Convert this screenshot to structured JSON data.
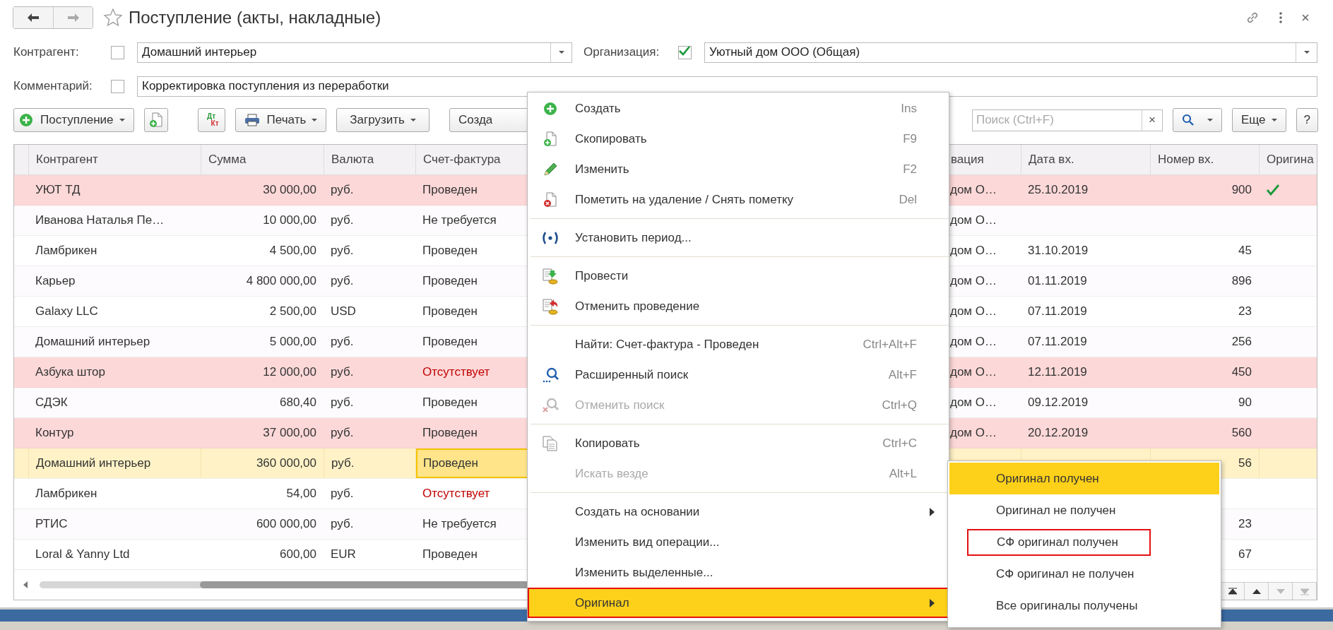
{
  "window": {
    "title": "Поступление (акты, накладные)"
  },
  "filters": [
    {
      "kind": "select",
      "label": "Контрагент:",
      "checked": false,
      "value": "Домашний интерьер"
    },
    {
      "kind": "select",
      "label": "Организация:",
      "checked": true,
      "value": "Уютный дом ООО (Общая)"
    },
    {
      "kind": "text",
      "label": "Комментарий:",
      "checked": false,
      "value": "Корректировка поступления из переработки"
    }
  ],
  "toolbar": {
    "left": [
      {
        "kind": "add",
        "label": "Поступление",
        "dropdown": true
      },
      {
        "kind": "copy"
      },
      {
        "kind": "accounts",
        "debit": "Дт",
        "credit": "Кт"
      },
      {
        "kind": "print",
        "label": "Печать",
        "dropdown": true
      },
      {
        "kind": "text",
        "label": "Загрузить",
        "dropdown": true
      },
      {
        "kind": "text",
        "label": "Созда",
        "dropdown": false
      }
    ],
    "search": {
      "placeholder": "Поиск (Ctrl+F)",
      "clear": "×"
    },
    "right": [
      {
        "kind": "search",
        "dropdown": true
      },
      {
        "kind": "text",
        "label": "Еще",
        "dropdown": true
      },
      {
        "kind": "text",
        "label": "?",
        "dropdown": false
      }
    ]
  },
  "table": {
    "columns": [
      "Контрагент",
      "Сумма",
      "Валюта",
      "Счет-фактура",
      "вация",
      "Дата вх.",
      "Номер вх.",
      "Оригина"
    ],
    "rows": [
      {
        "contractor": "УЮТ ТД",
        "sum": "30 000,00",
        "currency": "руб.",
        "invoice": "Проведен",
        "column_5": "дом О…",
        "date": "25.10.2019",
        "number": "900",
        "highlighted": true,
        "selected": false,
        "invoice_warning": false,
        "original_received": true
      },
      {
        "contractor": "Иванова Наталья Пе…",
        "sum": "10 000,00",
        "currency": "руб.",
        "invoice": "Не требуется",
        "column_5": "дом О…",
        "highlighted": false,
        "selected": false,
        "invoice_warning": false,
        "original_received": false
      },
      {
        "contractor": "Ламбрикен",
        "sum": "4 500,00",
        "currency": "руб.",
        "invoice": "Проведен",
        "column_5": "дом О…",
        "date": "31.10.2019",
        "number": "45",
        "highlighted": false,
        "selected": false,
        "invoice_warning": false,
        "original_received": false
      },
      {
        "contractor": "Карьер",
        "sum": "4 800 000,00",
        "currency": "руб.",
        "invoice": "Проведен",
        "column_5": "дом О…",
        "date": "01.11.2019",
        "number": "896",
        "highlighted": false,
        "selected": false,
        "invoice_warning": false,
        "original_received": false
      },
      {
        "contractor": "Galaxy LLC",
        "sum": "2 500,00",
        "currency": "USD",
        "invoice": "Проведен",
        "column_5": "дом О…",
        "date": "07.11.2019",
        "number": "23",
        "highlighted": false,
        "selected": false,
        "invoice_warning": false,
        "original_received": false
      },
      {
        "contractor": "Домашний интерьер",
        "sum": "5 000,00",
        "currency": "руб.",
        "invoice": "Проведен",
        "column_5": "дом О…",
        "date": "07.11.2019",
        "number": "256",
        "highlighted": false,
        "selected": false,
        "invoice_warning": false,
        "original_received": false
      },
      {
        "contractor": "Азбука штор",
        "sum": "12 000,00",
        "currency": "руб.",
        "invoice": "Отсутствует",
        "column_5": "дом О…",
        "date": "12.11.2019",
        "number": "450",
        "highlighted": true,
        "selected": false,
        "invoice_warning": true,
        "original_received": false
      },
      {
        "contractor": "СДЭК",
        "sum": "680,40",
        "currency": "руб.",
        "invoice": "Проведен",
        "column_5": "дом О…",
        "date": "09.12.2019",
        "number": "90",
        "highlighted": false,
        "selected": false,
        "invoice_warning": false,
        "original_received": false
      },
      {
        "contractor": "Контур",
        "sum": "37 000,00",
        "currency": "руб.",
        "invoice": "Проведен",
        "column_5": "дом О…",
        "date": "20.12.2019",
        "number": "560",
        "highlighted": true,
        "selected": false,
        "invoice_warning": false,
        "original_received": false
      },
      {
        "contractor": "Домашний интерьер",
        "sum": "360 000,00",
        "currency": "руб.",
        "invoice": "Проведен",
        "number": "56",
        "highlighted": false,
        "selected": true,
        "invoice_warning": false,
        "original_received": false
      },
      {
        "contractor": "Ламбрикен",
        "sum": "54,00",
        "currency": "руб.",
        "invoice": "Отсутствует",
        "highlighted": false,
        "selected": false,
        "invoice_warning": true,
        "original_received": false
      },
      {
        "contractor": "РТИС",
        "sum": "600 000,00",
        "currency": "руб.",
        "invoice": "Не требуется",
        "number": "23",
        "highlighted": false,
        "selected": false,
        "invoice_warning": false,
        "original_received": false
      },
      {
        "contractor": "Loral & Yanny Ltd",
        "sum": "600,00",
        "currency": "EUR",
        "invoice": "Проведен",
        "number": "67",
        "highlighted": false,
        "selected": false,
        "invoice_warning": false,
        "original_received": false
      }
    ]
  },
  "context_menu": {
    "items": [
      {
        "kind": "item",
        "label": "Создать",
        "shortcut": "Ins",
        "disabled": false,
        "selected": false,
        "has_submenu": false
      },
      {
        "kind": "item",
        "label": "Скопировать",
        "shortcut": "F9",
        "disabled": false,
        "selected": false,
        "has_submenu": false
      },
      {
        "kind": "item",
        "label": "Изменить",
        "shortcut": "F2",
        "disabled": false,
        "selected": false,
        "has_submenu": false
      },
      {
        "kind": "item",
        "label": "Пометить на удаление / Снять пометку",
        "shortcut": "Del",
        "disabled": false,
        "selected": false,
        "has_submenu": false
      },
      {
        "kind": "separator"
      },
      {
        "kind": "item",
        "label": "Установить период...",
        "disabled": false,
        "selected": false,
        "has_submenu": false
      },
      {
        "kind": "separator"
      },
      {
        "kind": "item",
        "label": "Провести",
        "disabled": false,
        "selected": false,
        "has_submenu": false
      },
      {
        "kind": "item",
        "label": "Отменить проведение",
        "disabled": false,
        "selected": false,
        "has_submenu": false
      },
      {
        "kind": "separator"
      },
      {
        "kind": "item",
        "label": "Найти: Счет-фактура - Проведен",
        "shortcut": "Ctrl+Alt+F",
        "disabled": false,
        "selected": false,
        "has_submenu": false
      },
      {
        "kind": "item",
        "label": "Расширенный поиск",
        "shortcut": "Alt+F",
        "disabled": false,
        "selected": false,
        "has_submenu": false
      },
      {
        "kind": "item",
        "label": "Отменить поиск",
        "shortcut": "Ctrl+Q",
        "disabled": true,
        "selected": false,
        "has_submenu": false
      },
      {
        "kind": "separator"
      },
      {
        "kind": "item",
        "label": "Копировать",
        "shortcut": "Ctrl+C",
        "disabled": false,
        "selected": false,
        "has_submenu": false
      },
      {
        "kind": "item",
        "label": "Искать везде",
        "shortcut": "Alt+L",
        "disabled": true,
        "selected": false,
        "has_submenu": false
      },
      {
        "kind": "separator"
      },
      {
        "kind": "item",
        "label": "Создать на основании",
        "disabled": false,
        "selected": false,
        "has_submenu": true
      },
      {
        "kind": "item",
        "label": "Изменить вид операции...",
        "disabled": false,
        "selected": false,
        "has_submenu": false
      },
      {
        "kind": "item",
        "label": "Изменить выделенные...",
        "disabled": false,
        "selected": false,
        "has_submenu": false
      },
      {
        "kind": "item",
        "label": "Оригинал",
        "disabled": false,
        "selected": true,
        "has_submenu": true,
        "outlined": true
      }
    ]
  },
  "submenu": {
    "items": [
      {
        "label": "Оригинал получен",
        "selected": true
      },
      {
        "label": "Оригинал не получен",
        "selected": false
      },
      {
        "label": "СФ оригинал получен",
        "selected": false,
        "outlined": true
      },
      {
        "label": "СФ оригинал не получен",
        "selected": false
      },
      {
        "label": "Все оригиналы получены",
        "selected": false
      }
    ]
  }
}
